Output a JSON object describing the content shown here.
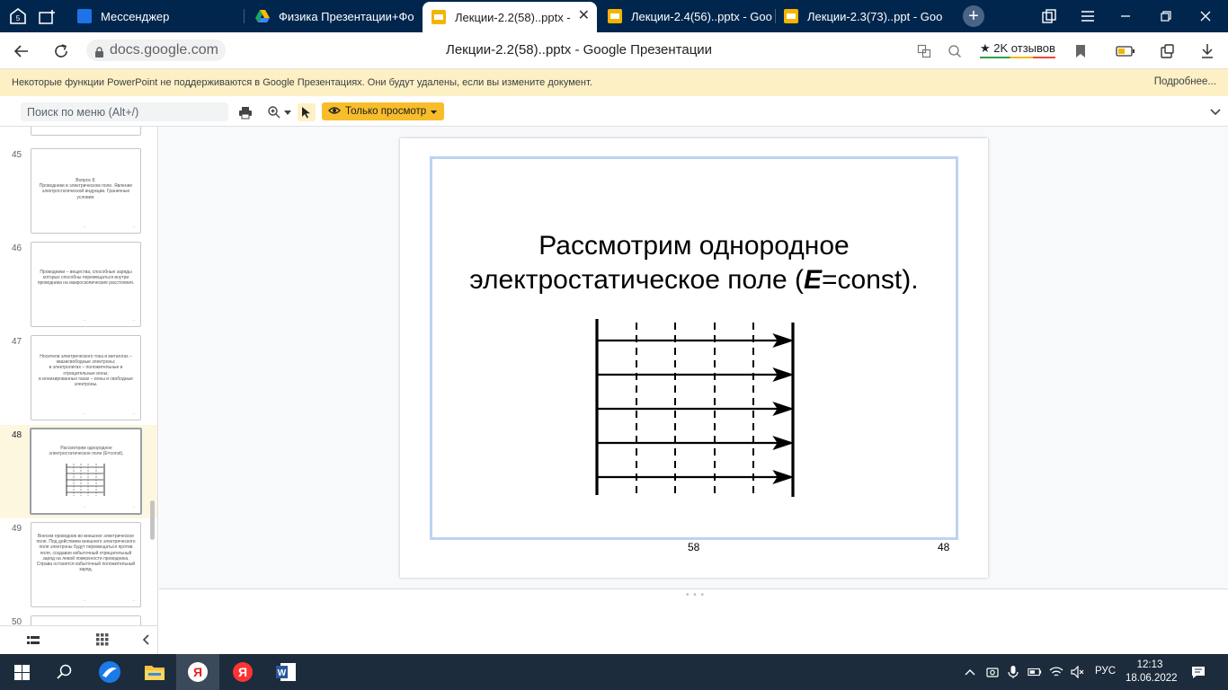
{
  "browser": {
    "tabs": [
      {
        "label": "Мессенджер",
        "favicon_color": "#1e73e8"
      },
      {
        "label": "Физика Презентации+Фо",
        "favicon_color": "#1fa463"
      },
      {
        "label": "Лекции-2.2(58)..pptx - G",
        "favicon_color": "#f4b400",
        "active": true
      },
      {
        "label": "Лекции-2.4(56)..pptx - Goo",
        "favicon_color": "#f4b400"
      },
      {
        "label": "Лекции-2.3(73)..ppt - Goo",
        "favicon_color": "#f4b400"
      }
    ],
    "tab_close": "✕",
    "new_tab": "+",
    "url": "docs.google.com",
    "page_title": "Лекции-2.2(58)..pptx - Google Презентации",
    "reviews_label": "2K отзывов",
    "reviews_star": "★"
  },
  "banner": {
    "message": "Некоторые функции PowerPoint не поддерживаются в Google Презентациях. Они будут удалены, если вы измените документ.",
    "more_link": "Подробнее..."
  },
  "toolbar": {
    "menu_search_placeholder": "Поиск по меню (Alt+/)",
    "view_only_label": "Только просмотр"
  },
  "sidebar": {
    "thumbnails": [
      {
        "number": "45",
        "text": "Вопрос 8.\nПроводники в электрическом поле. Явление электростатической индукции. Граничные условия.",
        "page": "--",
        "idx": "--"
      },
      {
        "number": "46",
        "text": "Проводники – вещества, способные заряды которых способны перемещаться внутри проводника на макроскопические расстояния.",
        "page": "--",
        "idx": "--"
      },
      {
        "number": "47",
        "text": "Носители электрического тока в металлах – квазисвободные электроны;\nв электролитах – положительные и отрицательные ионы;\nв ионизированных газах – ионы и свободные электроны.",
        "page": "--",
        "idx": "--"
      },
      {
        "number": "48",
        "text": "Рассмотрим однородное электростатическое поле (E=const).",
        "page": "--",
        "idx": "--",
        "selected": true
      },
      {
        "number": "49",
        "text": "Внесем проводник во внешнее электрическое поле. Под действием внешнего электрического поля электроны будут перемещаться против поля, создавая избыточный отрицательный заряд на левой поверхности проводника. Справа останется избыточный положительный заряд.",
        "page": "--",
        "idx": "--"
      },
      {
        "number": "50",
        "text": "",
        "page": "",
        "idx": ""
      }
    ]
  },
  "slide": {
    "title_line1": "Рассмотрим однородное",
    "title_line2_prefix": "электростатическое поле (",
    "title_emph": "E",
    "title_line2_suffix": "=const).",
    "page_number": "58",
    "slide_index": "48"
  },
  "taskbar": {
    "lang": "РУС",
    "time": "12:13",
    "date": "18.06.2022"
  }
}
